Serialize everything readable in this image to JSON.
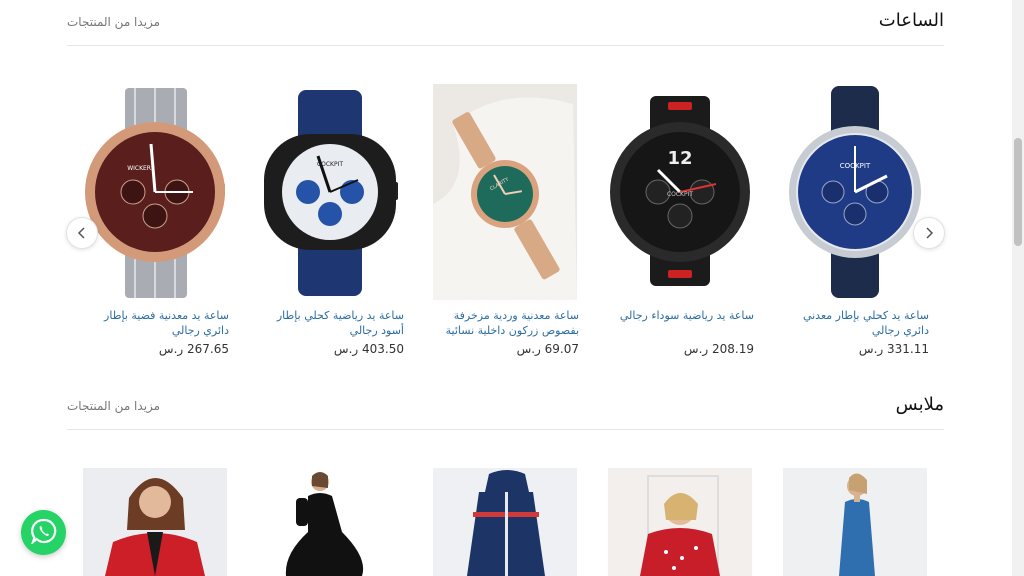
{
  "watches_section": {
    "title": "الساعات",
    "more_link": "مزيدا من المنتجات",
    "products": [
      {
        "name": "ساعة يد كحلي بإطار معدني دائري رجالي",
        "price": "331.11 ر.س"
      },
      {
        "name": "ساعة يد رياضية سوداء رجالي",
        "price": "208.19 ر.س"
      },
      {
        "name": "ساعة معدنية وردية مزخرفة بفصوص زركون داخلية نسائية",
        "price": "69.07 ر.س"
      },
      {
        "name": "ساعة يد رياضية كحلي بإطار أسود رجالي",
        "price": "403.50 ر.س"
      },
      {
        "name": "ساعة يد معدنية فضية بإطار دائري رجالي",
        "price": "267.65 ر.س"
      }
    ]
  },
  "clothes_section": {
    "title": "ملابس",
    "more_link": "مزيدا من المنتجات"
  },
  "watch_brands": [
    "COCKPIT",
    "COCKPIT",
    "CLARITY",
    "COCKPIT",
    "WICKERS"
  ],
  "icons": {
    "prev": "chevron-left-icon",
    "next": "chevron-right-icon",
    "whatsapp": "whatsapp-icon"
  },
  "colors": {
    "link": "#2b6ca3",
    "whatsapp": "#25d366"
  }
}
